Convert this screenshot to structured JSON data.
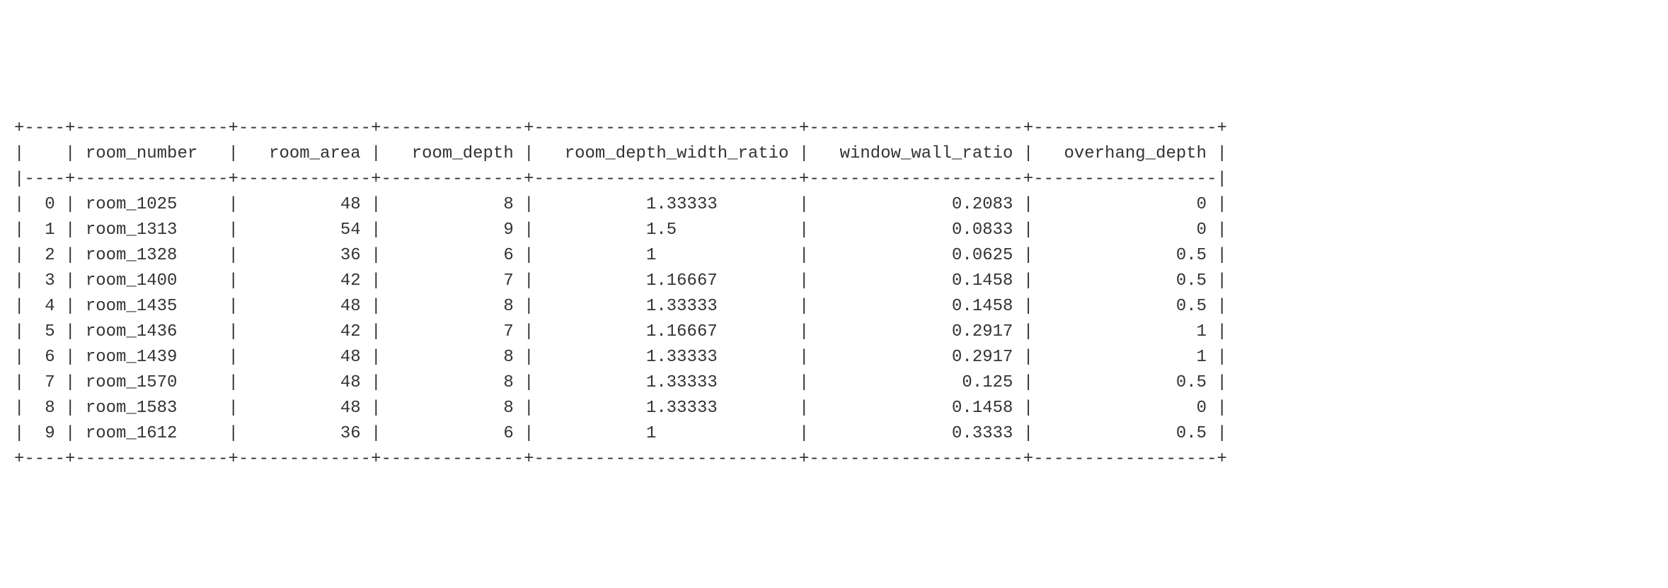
{
  "chart_data": {
    "type": "table",
    "title": "",
    "columns": [
      "",
      "room_number",
      "room_area",
      "room_depth",
      "room_depth_width_ratio",
      "window_wall_ratio",
      "overhang_depth"
    ],
    "rows": [
      {
        "idx": "0",
        "room_number": "room_1025",
        "room_area": "48",
        "room_depth": "8",
        "room_depth_width_ratio": "1.33333",
        "window_wall_ratio": "0.2083",
        "overhang_depth": "0"
      },
      {
        "idx": "1",
        "room_number": "room_1313",
        "room_area": "54",
        "room_depth": "9",
        "room_depth_width_ratio": "1.5",
        "window_wall_ratio": "0.0833",
        "overhang_depth": "0"
      },
      {
        "idx": "2",
        "room_number": "room_1328",
        "room_area": "36",
        "room_depth": "6",
        "room_depth_width_ratio": "1",
        "window_wall_ratio": "0.0625",
        "overhang_depth": "0.5"
      },
      {
        "idx": "3",
        "room_number": "room_1400",
        "room_area": "42",
        "room_depth": "7",
        "room_depth_width_ratio": "1.16667",
        "window_wall_ratio": "0.1458",
        "overhang_depth": "0.5"
      },
      {
        "idx": "4",
        "room_number": "room_1435",
        "room_area": "48",
        "room_depth": "8",
        "room_depth_width_ratio": "1.33333",
        "window_wall_ratio": "0.1458",
        "overhang_depth": "0.5"
      },
      {
        "idx": "5",
        "room_number": "room_1436",
        "room_area": "42",
        "room_depth": "7",
        "room_depth_width_ratio": "1.16667",
        "window_wall_ratio": "0.2917",
        "overhang_depth": "1"
      },
      {
        "idx": "6",
        "room_number": "room_1439",
        "room_area": "48",
        "room_depth": "8",
        "room_depth_width_ratio": "1.33333",
        "window_wall_ratio": "0.2917",
        "overhang_depth": "1"
      },
      {
        "idx": "7",
        "room_number": "room_1570",
        "room_area": "48",
        "room_depth": "8",
        "room_depth_width_ratio": "1.33333",
        "window_wall_ratio": "0.125",
        "overhang_depth": "0.5"
      },
      {
        "idx": "8",
        "room_number": "room_1583",
        "room_area": "48",
        "room_depth": "8",
        "room_depth_width_ratio": "1.33333",
        "window_wall_ratio": "0.1458",
        "overhang_depth": "0"
      },
      {
        "idx": "9",
        "room_number": "room_1612",
        "room_area": "36",
        "room_depth": "6",
        "room_depth_width_ratio": "1",
        "window_wall_ratio": "0.3333",
        "overhang_depth": "0.5"
      }
    ]
  },
  "col_widths": {
    "idx": 4,
    "room_number": 15,
    "room_area": 13,
    "room_depth": 14,
    "room_depth_width_ratio": 26,
    "window_wall_ratio": 21,
    "overhang_depth": 18
  },
  "alignment": {
    "idx": "right",
    "room_number": "left",
    "room_area": "right",
    "room_depth": "right",
    "room_depth_width_ratio": "ratio",
    "window_wall_ratio": "right",
    "overhang_depth": "right"
  }
}
